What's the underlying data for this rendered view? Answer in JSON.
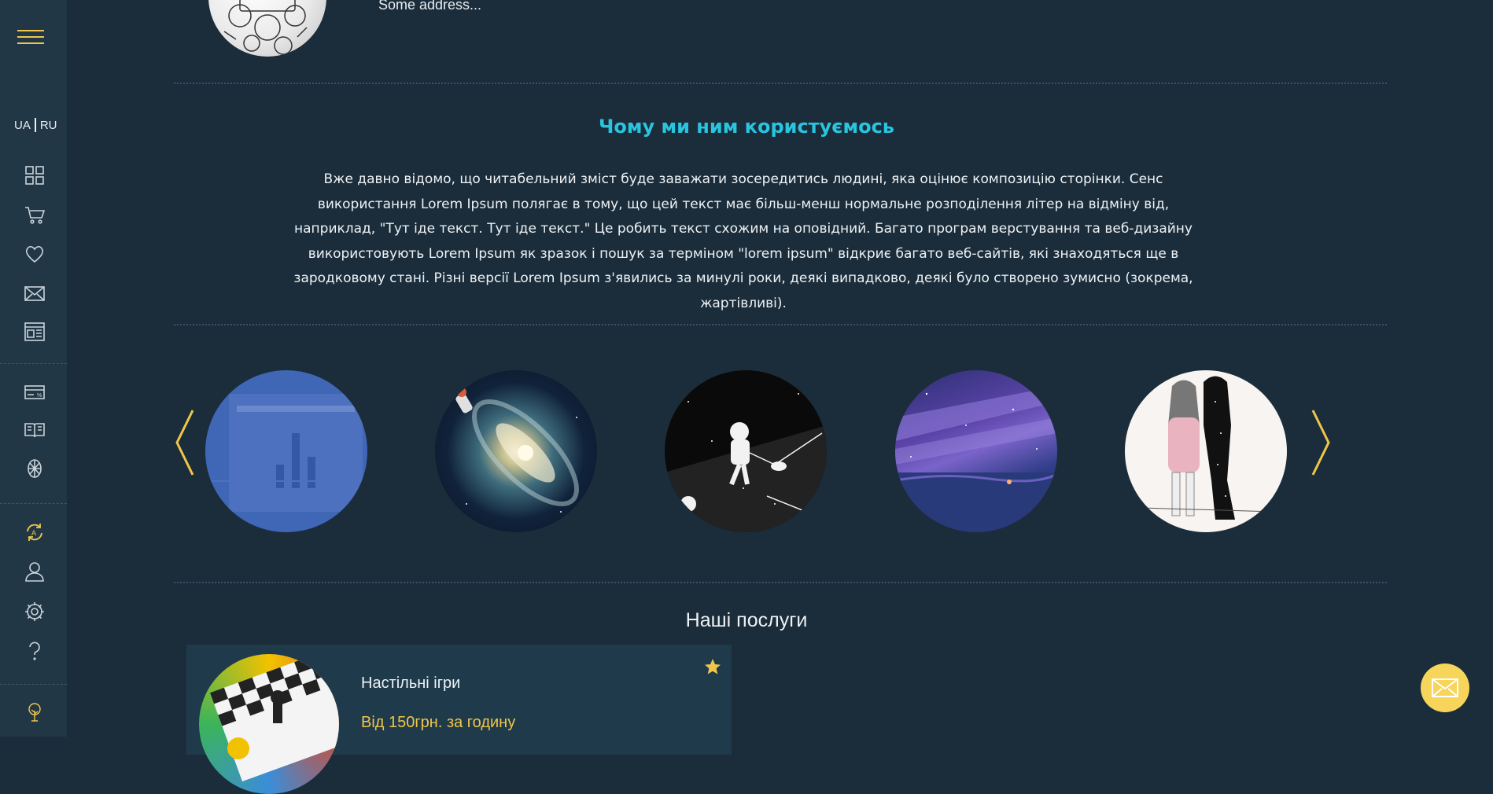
{
  "sidebar": {
    "lang_ua": "UA",
    "lang_ru": "RU",
    "items": [
      {
        "icon": "grid-icon"
      },
      {
        "icon": "cart-icon"
      },
      {
        "icon": "heart-icon"
      },
      {
        "icon": "mail-icon"
      },
      {
        "icon": "layout-icon"
      },
      {
        "icon": "discount-card-icon"
      },
      {
        "icon": "book-icon"
      },
      {
        "icon": "sport-icon"
      },
      {
        "icon": "translate-refresh-icon"
      },
      {
        "icon": "user-icon"
      },
      {
        "icon": "settings-icon"
      },
      {
        "icon": "help-icon"
      },
      {
        "icon": "tree-logo-icon"
      }
    ],
    "accent": "#f0c64a"
  },
  "profile": {
    "address": "Some address..."
  },
  "about": {
    "title": "Чому ми ним користуємось",
    "text": "Вже давно відомо, що читабельний зміст буде заважати зосередитись людині, яка оцінює композицію сторінки. Сенс використання Lorem Ipsum полягає в тому, що цей текст має більш-менш нормальне розподілення літер на відміну від, наприклад, \"Тут іде текст. Тут іде текст.\" Це робить текст схожим на оповідний. Багато програм верстування та веб-дизайну використовують Lorem Ipsum як зразок і пошук за терміном \"lorem ipsum\" відкриє багато веб-сайтів, які знаходяться ще в зародковому стані. Різні версії Lorem Ipsum з'явились за минулі роки, деякі випадково, деякі було створено зумисно (зокрема, жартівливі)."
  },
  "carousel": {
    "prev": "‹",
    "next": "›",
    "slides": [
      {
        "name": "dashboard-image"
      },
      {
        "name": "galaxy-astronaut-image"
      },
      {
        "name": "astronaut-vacuum-image"
      },
      {
        "name": "purple-night-sky-image"
      },
      {
        "name": "girl-shadow-image"
      }
    ]
  },
  "services": {
    "title": "Наші послуги",
    "items": [
      {
        "name": "Настільні ігри",
        "price": "Від 150грн. за годину"
      }
    ]
  },
  "colors": {
    "background": "#1b2d3b",
    "sidebar": "#223746",
    "title_accent": "#29c5df",
    "gold": "#f0c64a",
    "fab": "#f6d55a"
  }
}
